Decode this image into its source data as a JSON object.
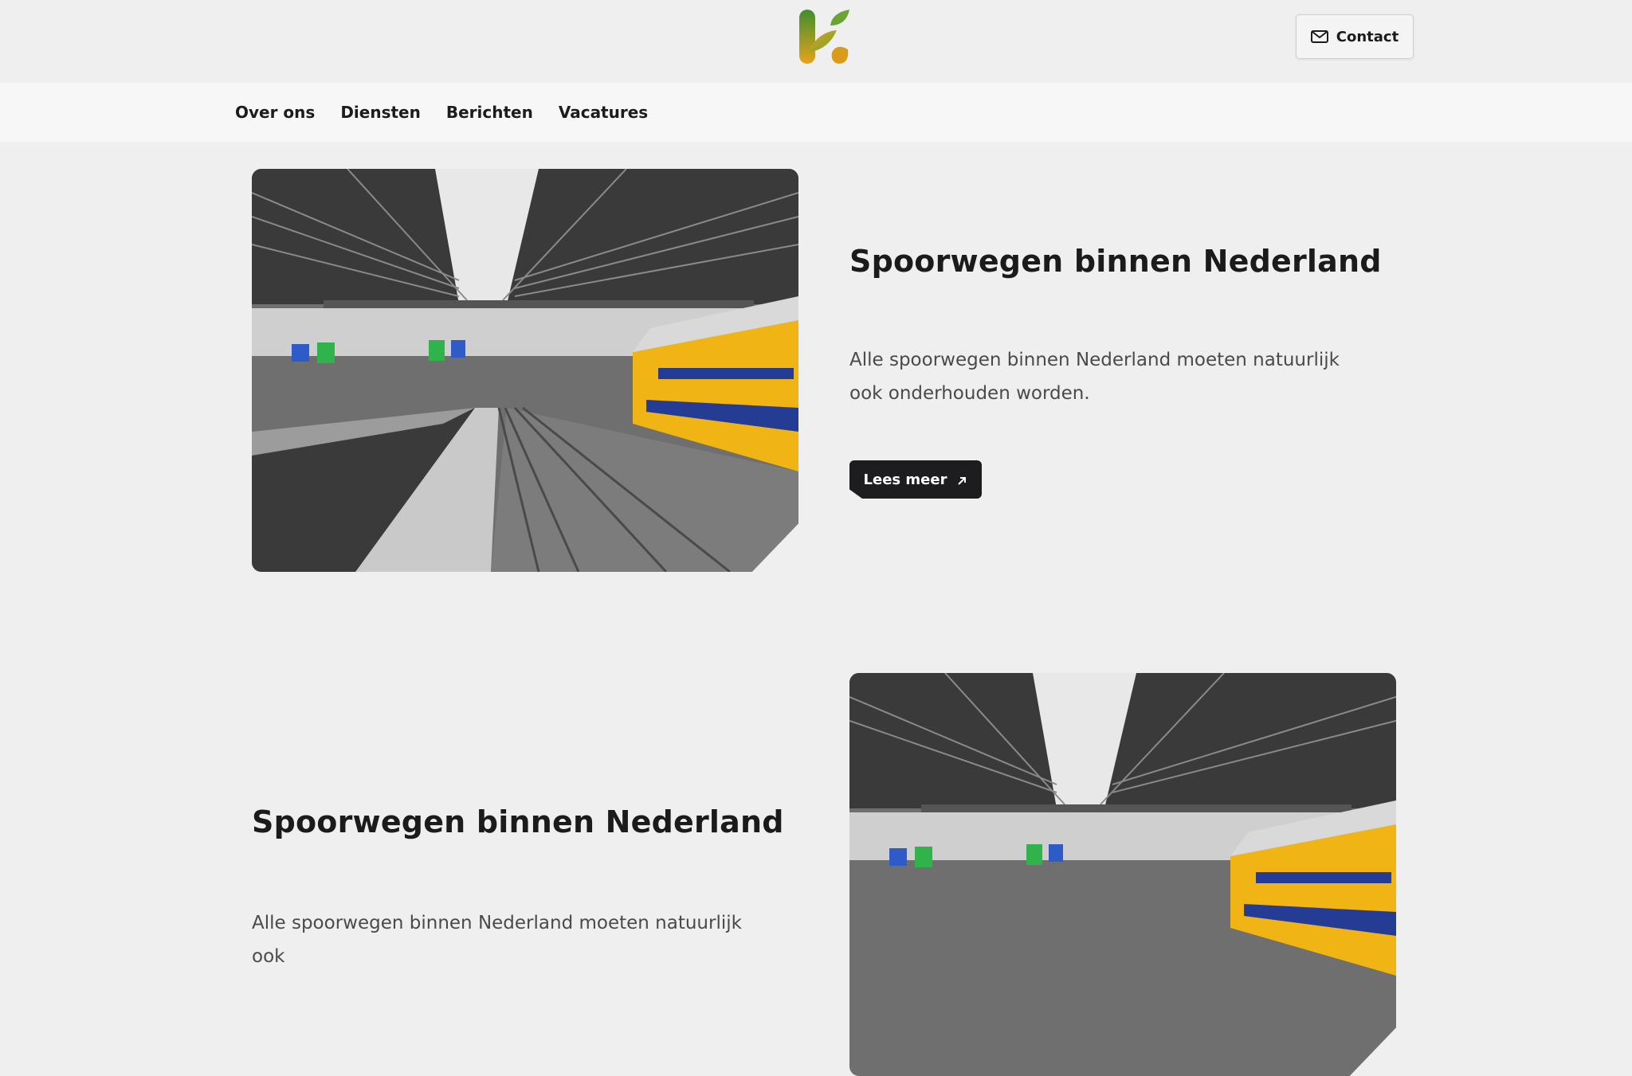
{
  "header": {
    "logo_name": "k-leaf-logo",
    "contact_label": "Contact",
    "contact_icon": "mail-icon"
  },
  "nav": {
    "items": [
      {
        "label": "Over ons"
      },
      {
        "label": "Diensten"
      },
      {
        "label": "Berichten"
      },
      {
        "label": "Vacatures"
      }
    ]
  },
  "sections": [
    {
      "title": "Spoorwegen binnen Nederland",
      "text": "Alle spoorwegen binnen Nederland moeten natuurlijk ook onderhouden worden.",
      "button_label": "Lees meer",
      "button_icon": "arrow-up-right-icon",
      "image": "train-station-photo"
    },
    {
      "title": "Spoorwegen binnen Nederland",
      "text": "Alle spoorwegen binnen Nederland moeten natuurlijk ook",
      "image": "train-station-photo"
    }
  ],
  "colors": {
    "background": "#efefef",
    "nav_background": "#f7f7f7",
    "button_dark": "#1d1d1f",
    "logo_green": "#5a9a2a",
    "logo_orange": "#e7a21b",
    "train_yellow": "#f0b415",
    "train_blue": "#243c94"
  }
}
